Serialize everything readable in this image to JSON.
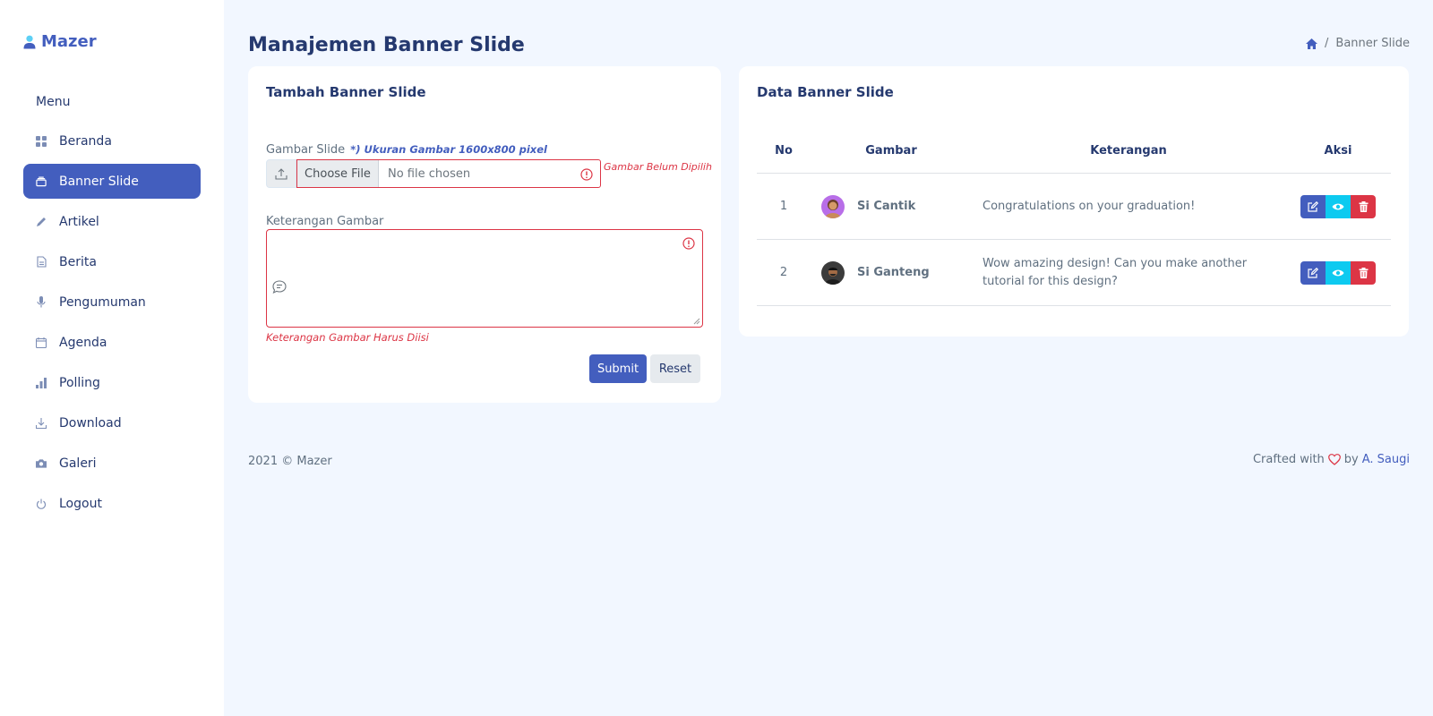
{
  "sidebar": {
    "logo": "Mazer",
    "menu_title": "Menu",
    "items": [
      {
        "label": "Beranda",
        "icon": "grid-icon"
      },
      {
        "label": "Banner Slide",
        "icon": "collection-icon",
        "active": true
      },
      {
        "label": "Artikel",
        "icon": "pen-icon"
      },
      {
        "label": "Berita",
        "icon": "file-icon"
      },
      {
        "label": "Pengumuman",
        "icon": "mic-icon"
      },
      {
        "label": "Agenda",
        "icon": "calendar-icon"
      },
      {
        "label": "Polling",
        "icon": "bar-chart-icon"
      },
      {
        "label": "Download",
        "icon": "download-icon"
      },
      {
        "label": "Galeri",
        "icon": "camera-icon"
      },
      {
        "label": "Logout",
        "icon": "power-icon"
      }
    ]
  },
  "header": {
    "title": "Manajemen Banner Slide",
    "breadcrumb_current": "Banner Slide",
    "breadcrumb_separator": "/"
  },
  "form": {
    "title": "Tambah Banner Slide",
    "image_label": "Gambar Slide",
    "image_hint": "*) Ukuran Gambar 1600x800 pixel",
    "choose_file": "Choose File",
    "file_status": "No file chosen",
    "image_error": "Gambar Belum Dipilih",
    "desc_label": "Keterangan Gambar",
    "desc_value": "",
    "desc_error": "Keterangan Gambar Harus Diisi",
    "submit": "Submit",
    "reset": "Reset"
  },
  "table": {
    "title": "Data Banner Slide",
    "columns": [
      "No",
      "Gambar",
      "Keterangan",
      "Aksi"
    ],
    "rows": [
      {
        "no": "1",
        "name": "Si Cantik",
        "desc": "Congratulations on your graduation!"
      },
      {
        "no": "2",
        "name": "Si Ganteng",
        "desc": "Wow amazing design! Can you make another tutorial for this design?"
      }
    ]
  },
  "footer": {
    "copyright": "2021 © Mazer",
    "crafted": "Crafted with",
    "by": "by",
    "author": "A. Saugi"
  },
  "colors": {
    "primary": "#435ebe",
    "danger": "#dc3545",
    "info": "#0dcaf0",
    "background": "#f2f7ff"
  }
}
